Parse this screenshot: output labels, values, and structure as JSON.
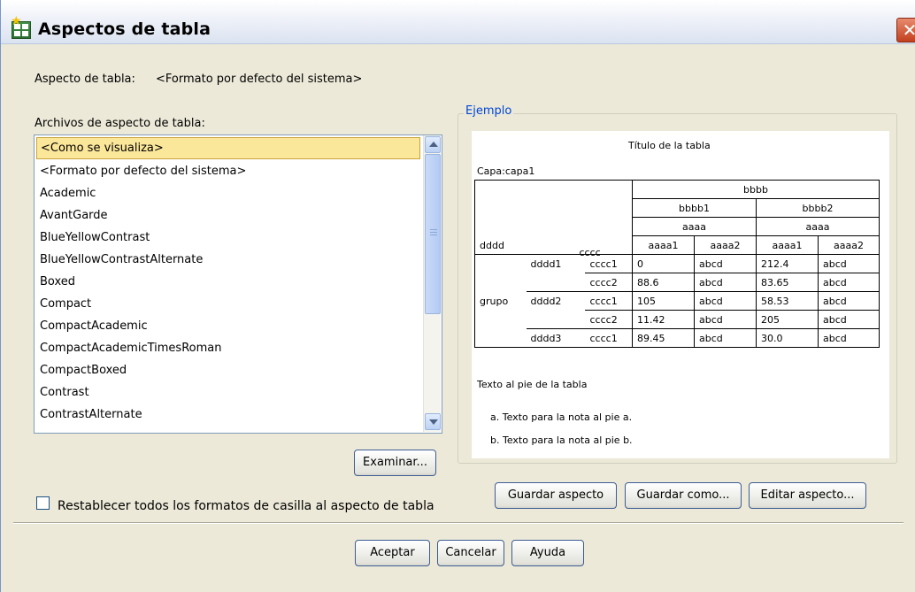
{
  "window": {
    "title": "Aspectos de tabla",
    "close_glyph": "✕"
  },
  "current_look": {
    "label": "Aspecto de tabla:",
    "value": "<Formato por defecto del sistema>"
  },
  "files_label": "Archivos de aspecto de tabla:",
  "files": [
    "<Como se visualiza>",
    "<Formato por defecto del sistema>",
    "Academic",
    "AvantGarde",
    "BlueYellowContrast",
    "BlueYellowContrastAlternate",
    "Boxed",
    "Compact",
    "CompactAcademic",
    "CompactAcademicTimesRoman",
    "CompactBoxed",
    "Contrast",
    "ContrastAlternate"
  ],
  "selected_file": "<Como se visualiza>",
  "buttons": {
    "browse": "Examinar...",
    "save_look": "Guardar aspecto",
    "save_as": "Guardar como...",
    "edit_look": "Editar aspecto...",
    "ok": "Aceptar",
    "cancel": "Cancelar",
    "help": "Ayuda"
  },
  "reset_checkbox": {
    "label": "Restablecer todos los formatos de casilla al aspecto de tabla",
    "checked": false
  },
  "sample": {
    "group_label": "Ejemplo",
    "title": "Título de la tabla",
    "layer": "Capa:capa1",
    "col_top": "bbbb",
    "col_b1": "bbbb1",
    "col_b2": "bbbb2",
    "col_a_1": "aaaa",
    "col_a_2": "aaaa",
    "row_header": "dddd",
    "sub_header": "cccc",
    "cols": [
      "aaaa1",
      "aaaa2",
      "aaaa1",
      "aaaa2"
    ],
    "rows": [
      {
        "g": "",
        "d": "dddd1",
        "c": "cccc1",
        "v": [
          "0",
          "abcd",
          "212.4",
          "abcd"
        ]
      },
      {
        "g": "",
        "d": "",
        "c": "cccc2",
        "v": [
          "88.6",
          "abcd",
          "83.65",
          "abcd"
        ]
      },
      {
        "g": "grupo",
        "d": "dddd2",
        "c": "cccc1",
        "v": [
          "105",
          "abcd",
          "58.53",
          "abcd"
        ]
      },
      {
        "g": "",
        "d": "",
        "c": "cccc2",
        "v": [
          "11.42",
          "abcd",
          "205",
          "abcd"
        ]
      },
      {
        "g": "",
        "d": "dddd3",
        "c": "cccc1",
        "v": [
          "89.45",
          "abcd",
          "30.0",
          "abcd"
        ]
      }
    ],
    "footer": "Texto al pie de la tabla",
    "note_a": "a. Texto para la nota al pie a.",
    "note_b": "b. Texto para la nota al pie b."
  }
}
